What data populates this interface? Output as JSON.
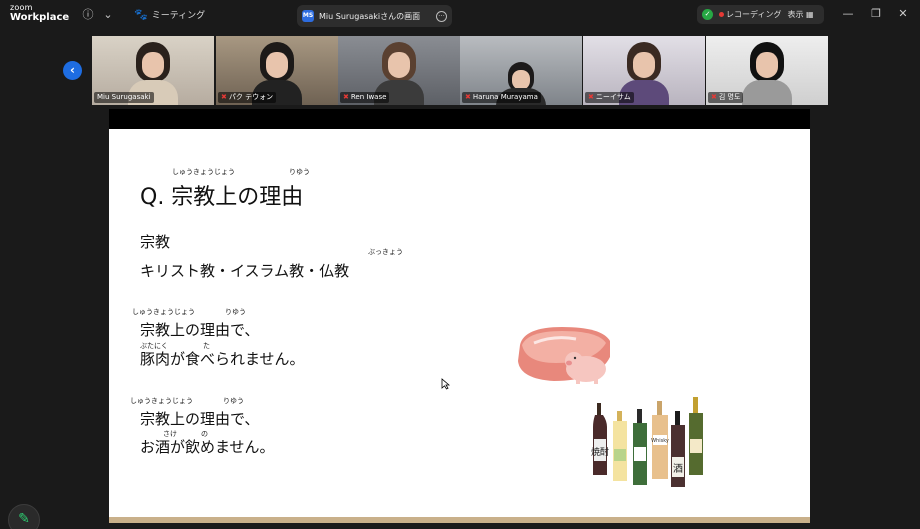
{
  "app": {
    "logo_line1": "zoom",
    "logo_line2": "Workplace"
  },
  "titlebar": {
    "meeting_label": "ミーティング",
    "tab_badge": "MS",
    "tab_title": "Miu Surugasakiさんの画面",
    "recording_label": "レコーディング",
    "view_label": "表示"
  },
  "participants": [
    {
      "name": "Miu Surugasaki",
      "muted": false
    },
    {
      "name": "パク テウォン",
      "muted": true
    },
    {
      "name": "Ren Iwase",
      "muted": true
    },
    {
      "name": "Haruna Murayama",
      "muted": true
    },
    {
      "name": "ニーイサム",
      "muted": true
    },
    {
      "name": "김 명도",
      "muted": true
    }
  ],
  "slide": {
    "q_ruby_1": "しゅうきょうじょう",
    "q_ruby_2": "りゆう",
    "title": "Q. 宗教上の理由",
    "religion_label": "宗教",
    "buddhism_ruby": "ぶっきょう",
    "religions": "キリスト教・イスラム教・仏教",
    "r1_ruby_a": "しゅうきょうじょう",
    "r1_ruby_b": "りゆう",
    "r1_line1": "宗教上の理由で、",
    "r1_ruby_c": "ぶたにく",
    "r1_ruby_d": "た",
    "r1_line2": "豚肉が食べられません。",
    "r2_ruby_a": "しゅうきょうじょう",
    "r2_ruby_b": "りゆう",
    "r2_line1": "宗教上の理由で、",
    "r2_ruby_c": "さけ",
    "r2_ruby_d": "の",
    "r2_line2": "お酒が飲めません。",
    "bottle_label_1": "焼酎",
    "bottle_label_2": "Whisky",
    "bottle_label_3": "酒"
  }
}
